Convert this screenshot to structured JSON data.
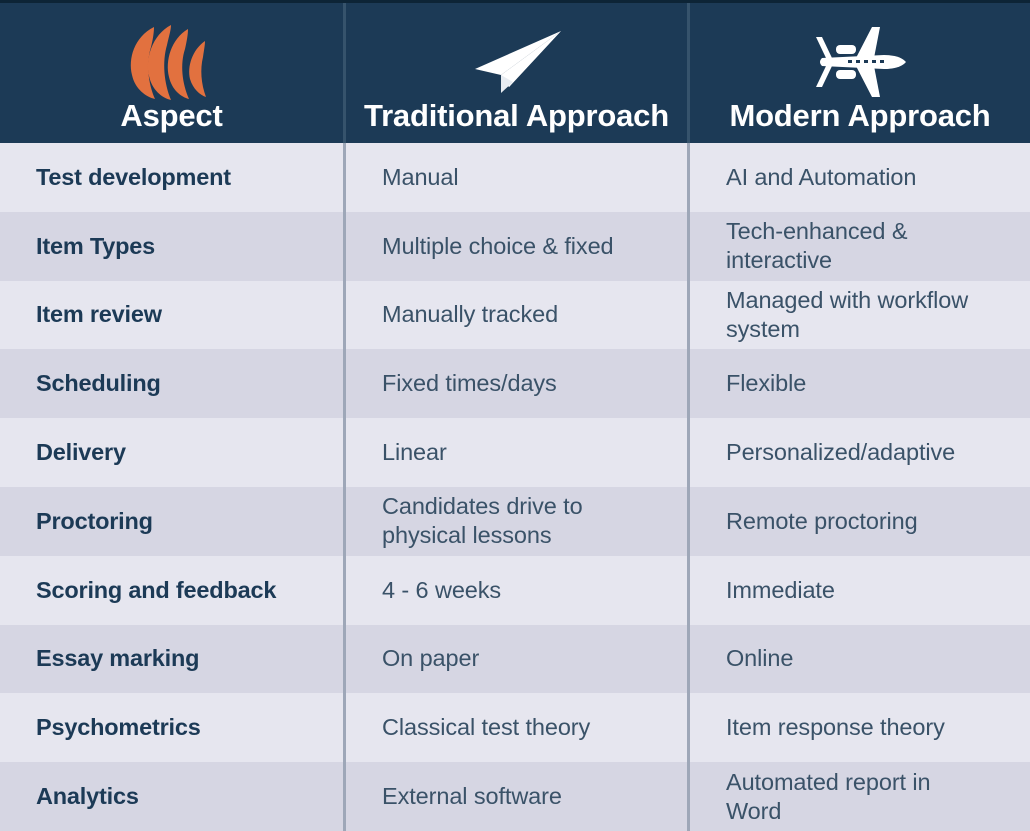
{
  "header": {
    "columns": [
      {
        "label": "Aspect",
        "icon": "flame-waves-logo-icon"
      },
      {
        "label": "Traditional Approach",
        "icon": "paper-plane-icon"
      },
      {
        "label": "Modern Approach",
        "icon": "jet-airplane-icon"
      }
    ]
  },
  "colors": {
    "header_bg": "#1c3a56",
    "accent_orange": "#e2713f",
    "row_light": "#e6e6ef",
    "row_dark": "#d6d6e3",
    "aspect_text": "#1c3a56",
    "cell_text": "#3a5268",
    "divider": "#9ea7b8"
  },
  "rows": [
    {
      "aspect": "Test development",
      "traditional": "Manual",
      "modern": "AI and Automation"
    },
    {
      "aspect": "Item Types",
      "traditional": "Multiple choice & fixed",
      "modern": "Tech-enhanced &\ninteractive"
    },
    {
      "aspect": "Item review",
      "traditional": "Manually tracked",
      "modern": "Managed with workflow\nsystem"
    },
    {
      "aspect": "Scheduling",
      "traditional": "Fixed times/days",
      "modern": "Flexible"
    },
    {
      "aspect": "Delivery",
      "traditional": "Linear",
      "modern": "Personalized/adaptive"
    },
    {
      "aspect": "Proctoring",
      "traditional": "Candidates drive to\nphysical lessons",
      "modern": "Remote proctoring"
    },
    {
      "aspect": "Scoring and feedback",
      "traditional": "4 - 6 weeks",
      "modern": "Immediate"
    },
    {
      "aspect": "Essay marking",
      "traditional": "On paper",
      "modern": "Online"
    },
    {
      "aspect": "Psychometrics",
      "traditional": "Classical test theory",
      "modern": "Item response theory"
    },
    {
      "aspect": "Analytics",
      "traditional": "External software",
      "modern": "Automated report in\nWord"
    }
  ]
}
